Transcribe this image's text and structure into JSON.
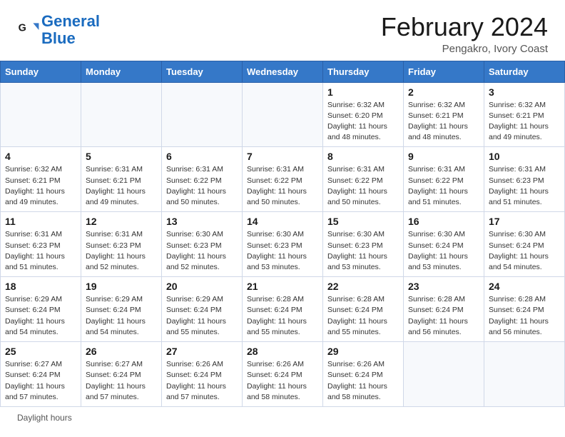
{
  "header": {
    "logo_line1": "General",
    "logo_line2": "Blue",
    "main_title": "February 2024",
    "subtitle": "Pengakro, Ivory Coast"
  },
  "days_of_week": [
    "Sunday",
    "Monday",
    "Tuesday",
    "Wednesday",
    "Thursday",
    "Friday",
    "Saturday"
  ],
  "weeks": [
    [
      {
        "day": "",
        "detail": ""
      },
      {
        "day": "",
        "detail": ""
      },
      {
        "day": "",
        "detail": ""
      },
      {
        "day": "",
        "detail": ""
      },
      {
        "day": "1",
        "detail": "Sunrise: 6:32 AM\nSunset: 6:20 PM\nDaylight: 11 hours and 48 minutes."
      },
      {
        "day": "2",
        "detail": "Sunrise: 6:32 AM\nSunset: 6:21 PM\nDaylight: 11 hours and 48 minutes."
      },
      {
        "day": "3",
        "detail": "Sunrise: 6:32 AM\nSunset: 6:21 PM\nDaylight: 11 hours and 49 minutes."
      }
    ],
    [
      {
        "day": "4",
        "detail": "Sunrise: 6:32 AM\nSunset: 6:21 PM\nDaylight: 11 hours and 49 minutes."
      },
      {
        "day": "5",
        "detail": "Sunrise: 6:31 AM\nSunset: 6:21 PM\nDaylight: 11 hours and 49 minutes."
      },
      {
        "day": "6",
        "detail": "Sunrise: 6:31 AM\nSunset: 6:22 PM\nDaylight: 11 hours and 50 minutes."
      },
      {
        "day": "7",
        "detail": "Sunrise: 6:31 AM\nSunset: 6:22 PM\nDaylight: 11 hours and 50 minutes."
      },
      {
        "day": "8",
        "detail": "Sunrise: 6:31 AM\nSunset: 6:22 PM\nDaylight: 11 hours and 50 minutes."
      },
      {
        "day": "9",
        "detail": "Sunrise: 6:31 AM\nSunset: 6:22 PM\nDaylight: 11 hours and 51 minutes."
      },
      {
        "day": "10",
        "detail": "Sunrise: 6:31 AM\nSunset: 6:23 PM\nDaylight: 11 hours and 51 minutes."
      }
    ],
    [
      {
        "day": "11",
        "detail": "Sunrise: 6:31 AM\nSunset: 6:23 PM\nDaylight: 11 hours and 51 minutes."
      },
      {
        "day": "12",
        "detail": "Sunrise: 6:31 AM\nSunset: 6:23 PM\nDaylight: 11 hours and 52 minutes."
      },
      {
        "day": "13",
        "detail": "Sunrise: 6:30 AM\nSunset: 6:23 PM\nDaylight: 11 hours and 52 minutes."
      },
      {
        "day": "14",
        "detail": "Sunrise: 6:30 AM\nSunset: 6:23 PM\nDaylight: 11 hours and 53 minutes."
      },
      {
        "day": "15",
        "detail": "Sunrise: 6:30 AM\nSunset: 6:23 PM\nDaylight: 11 hours and 53 minutes."
      },
      {
        "day": "16",
        "detail": "Sunrise: 6:30 AM\nSunset: 6:24 PM\nDaylight: 11 hours and 53 minutes."
      },
      {
        "day": "17",
        "detail": "Sunrise: 6:30 AM\nSunset: 6:24 PM\nDaylight: 11 hours and 54 minutes."
      }
    ],
    [
      {
        "day": "18",
        "detail": "Sunrise: 6:29 AM\nSunset: 6:24 PM\nDaylight: 11 hours and 54 minutes."
      },
      {
        "day": "19",
        "detail": "Sunrise: 6:29 AM\nSunset: 6:24 PM\nDaylight: 11 hours and 54 minutes."
      },
      {
        "day": "20",
        "detail": "Sunrise: 6:29 AM\nSunset: 6:24 PM\nDaylight: 11 hours and 55 minutes."
      },
      {
        "day": "21",
        "detail": "Sunrise: 6:28 AM\nSunset: 6:24 PM\nDaylight: 11 hours and 55 minutes."
      },
      {
        "day": "22",
        "detail": "Sunrise: 6:28 AM\nSunset: 6:24 PM\nDaylight: 11 hours and 55 minutes."
      },
      {
        "day": "23",
        "detail": "Sunrise: 6:28 AM\nSunset: 6:24 PM\nDaylight: 11 hours and 56 minutes."
      },
      {
        "day": "24",
        "detail": "Sunrise: 6:28 AM\nSunset: 6:24 PM\nDaylight: 11 hours and 56 minutes."
      }
    ],
    [
      {
        "day": "25",
        "detail": "Sunrise: 6:27 AM\nSunset: 6:24 PM\nDaylight: 11 hours and 57 minutes."
      },
      {
        "day": "26",
        "detail": "Sunrise: 6:27 AM\nSunset: 6:24 PM\nDaylight: 11 hours and 57 minutes."
      },
      {
        "day": "27",
        "detail": "Sunrise: 6:26 AM\nSunset: 6:24 PM\nDaylight: 11 hours and 57 minutes."
      },
      {
        "day": "28",
        "detail": "Sunrise: 6:26 AM\nSunset: 6:24 PM\nDaylight: 11 hours and 58 minutes."
      },
      {
        "day": "29",
        "detail": "Sunrise: 6:26 AM\nSunset: 6:24 PM\nDaylight: 11 hours and 58 minutes."
      },
      {
        "day": "",
        "detail": ""
      },
      {
        "day": "",
        "detail": ""
      }
    ]
  ],
  "footer": {
    "daylight_label": "Daylight hours"
  }
}
